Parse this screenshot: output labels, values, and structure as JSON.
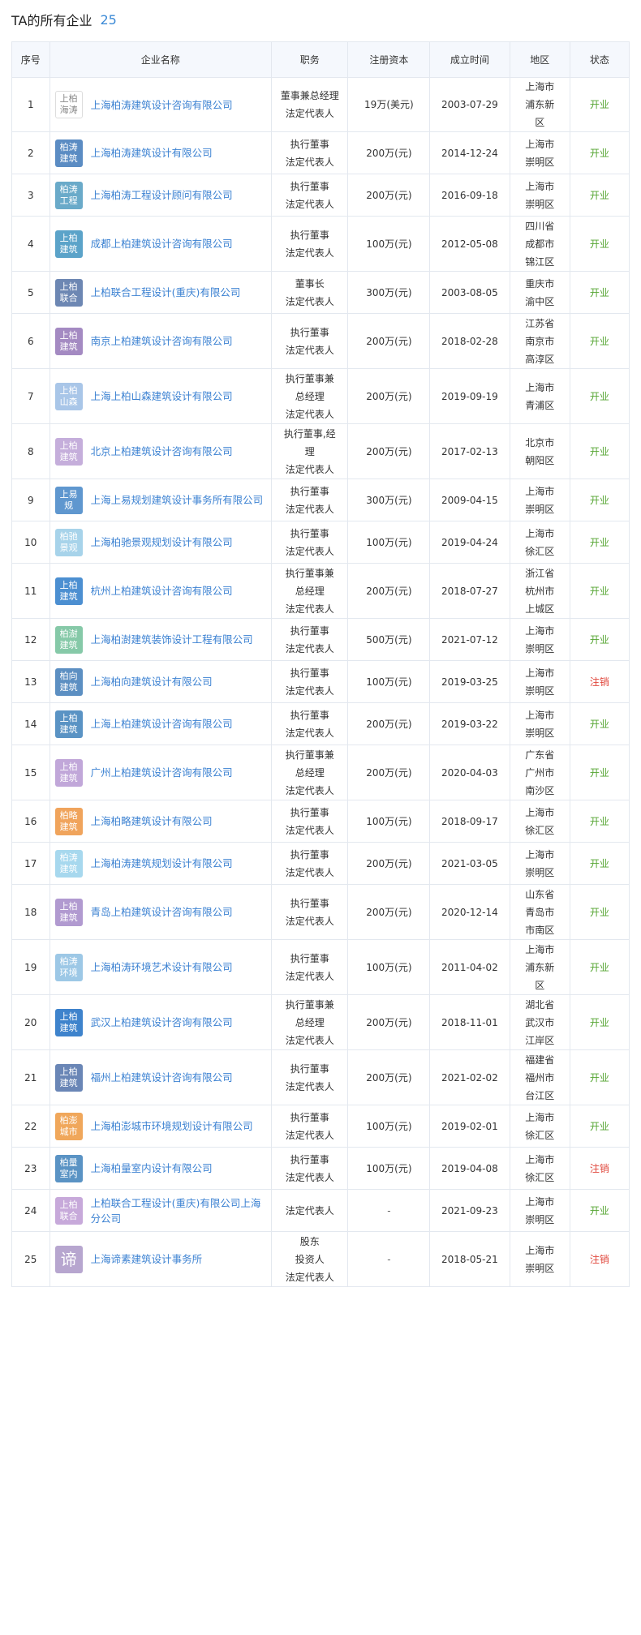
{
  "header": {
    "title": "TA的所有企业",
    "count": "25"
  },
  "columns": [
    "序号",
    "企业名称",
    "职务",
    "注册资本",
    "成立时间",
    "地区",
    "状态"
  ],
  "rows": [
    {
      "no": "1",
      "logo": "上柏\n海涛",
      "logo_color": "#ffffff",
      "logo_style": "light",
      "name": "上海柏涛建筑设计咨询有限公司",
      "role": "董事兼总经理\n法定代表人",
      "capital": "19万(美元)",
      "date": "2003-07-29",
      "region": "上海市\n浦东新\n区",
      "status": "开业"
    },
    {
      "no": "2",
      "logo": "柏涛\n建筑",
      "logo_color": "#5b8cc3",
      "name": "上海柏涛建筑设计有限公司",
      "role": "执行董事\n法定代表人",
      "capital": "200万(元)",
      "date": "2014-12-24",
      "region": "上海市\n崇明区",
      "status": "开业"
    },
    {
      "no": "3",
      "logo": "柏涛\n工程",
      "logo_color": "#6aaac9",
      "name": "上海柏涛工程设计顾问有限公司",
      "role": "执行董事\n法定代表人",
      "capital": "200万(元)",
      "date": "2016-09-18",
      "region": "上海市\n崇明区",
      "status": "开业"
    },
    {
      "no": "4",
      "logo": "上柏\n建筑",
      "logo_color": "#5ba3c9",
      "name": "成都上柏建筑设计咨询有限公司",
      "role": "执行董事\n法定代表人",
      "capital": "100万(元)",
      "date": "2012-05-08",
      "region": "四川省\n成都市\n锦江区",
      "status": "开业"
    },
    {
      "no": "5",
      "logo": "上柏\n联合",
      "logo_color": "#6d87b3",
      "name": "上柏联合工程设计(重庆)有限公司",
      "role": "董事长\n法定代表人",
      "capital": "300万(元)",
      "date": "2003-08-05",
      "region": "重庆市\n渝中区",
      "status": "开业"
    },
    {
      "no": "6",
      "logo": "上柏\n建筑",
      "logo_color": "#a48ac2",
      "name": "南京上柏建筑设计咨询有限公司",
      "role": "执行董事\n法定代表人",
      "capital": "200万(元)",
      "date": "2018-02-28",
      "region": "江苏省\n南京市\n高淳区",
      "status": "开业"
    },
    {
      "no": "7",
      "logo": "上柏\n山森",
      "logo_color": "#a9c6e8",
      "name": "上海上柏山森建筑设计有限公司",
      "role": "执行董事兼\n总经理\n法定代表人",
      "capital": "200万(元)",
      "date": "2019-09-19",
      "region": "上海市\n青浦区",
      "status": "开业"
    },
    {
      "no": "8",
      "logo": "上柏\n建筑",
      "logo_color": "#c5aedb",
      "name": "北京上柏建筑设计咨询有限公司",
      "role": "执行董事,经\n理\n法定代表人",
      "capital": "200万(元)",
      "date": "2017-02-13",
      "region": "北京市\n朝阳区",
      "status": "开业"
    },
    {
      "no": "9",
      "logo": "上易\n规",
      "logo_color": "#5f97cf",
      "name": "上海上易规划建筑设计事务所有限公司",
      "role": "执行董事\n法定代表人",
      "capital": "300万(元)",
      "date": "2009-04-15",
      "region": "上海市\n崇明区",
      "status": "开业"
    },
    {
      "no": "10",
      "logo": "柏驰\n景观",
      "logo_color": "#a7d3ea",
      "name": "上海柏驰景观规划设计有限公司",
      "role": "执行董事\n法定代表人",
      "capital": "100万(元)",
      "date": "2019-04-24",
      "region": "上海市\n徐汇区",
      "status": "开业"
    },
    {
      "no": "11",
      "logo": "上柏\n建筑",
      "logo_color": "#4c8fd1",
      "name": "杭州上柏建筑设计咨询有限公司",
      "role": "执行董事兼\n总经理\n法定代表人",
      "capital": "200万(元)",
      "date": "2018-07-27",
      "region": "浙江省\n杭州市\n上城区",
      "status": "开业"
    },
    {
      "no": "12",
      "logo": "柏澍\n建筑",
      "logo_color": "#86c9a8",
      "name": "上海柏澍建筑装饰设计工程有限公司",
      "role": "执行董事\n法定代表人",
      "capital": "500万(元)",
      "date": "2021-07-12",
      "region": "上海市\n崇明区",
      "status": "开业"
    },
    {
      "no": "13",
      "logo": "柏向\n建筑",
      "logo_color": "#5c8fc2",
      "name": "上海柏向建筑设计有限公司",
      "role": "执行董事\n法定代表人",
      "capital": "100万(元)",
      "date": "2019-03-25",
      "region": "上海市\n崇明区",
      "status": "注销"
    },
    {
      "no": "14",
      "logo": "上柏\n建筑",
      "logo_color": "#5a93c4",
      "name": "上海上柏建筑设计咨询有限公司",
      "role": "执行董事\n法定代表人",
      "capital": "200万(元)",
      "date": "2019-03-22",
      "region": "上海市\n崇明区",
      "status": "开业"
    },
    {
      "no": "15",
      "logo": "上柏\n建筑",
      "logo_color": "#c1a7d9",
      "name": "广州上柏建筑设计咨询有限公司",
      "role": "执行董事兼\n总经理\n法定代表人",
      "capital": "200万(元)",
      "date": "2020-04-03",
      "region": "广东省\n广州市\n南沙区",
      "status": "开业"
    },
    {
      "no": "16",
      "logo": "柏略\n建筑",
      "logo_color": "#f0a45c",
      "name": "上海柏略建筑设计有限公司",
      "role": "执行董事\n法定代表人",
      "capital": "100万(元)",
      "date": "2018-09-17",
      "region": "上海市\n徐汇区",
      "status": "开业"
    },
    {
      "no": "17",
      "logo": "柏涛\n建筑",
      "logo_color": "#a7d8ee",
      "name": "上海柏涛建筑规划设计有限公司",
      "role": "执行董事\n法定代表人",
      "capital": "200万(元)",
      "date": "2021-03-05",
      "region": "上海市\n崇明区",
      "status": "开业"
    },
    {
      "no": "18",
      "logo": "上柏\n建筑",
      "logo_color": "#b19ad0",
      "name": "青岛上柏建筑设计咨询有限公司",
      "role": "执行董事\n法定代表人",
      "capital": "200万(元)",
      "date": "2020-12-14",
      "region": "山东省\n青岛市\n市南区",
      "status": "开业"
    },
    {
      "no": "19",
      "logo": "柏涛\n环境",
      "logo_color": "#9dc8e6",
      "name": "上海柏涛环境艺术设计有限公司",
      "role": "执行董事\n法定代表人",
      "capital": "100万(元)",
      "date": "2011-04-02",
      "region": "上海市\n浦东新\n区",
      "status": "开业"
    },
    {
      "no": "20",
      "logo": "上柏\n建筑",
      "logo_color": "#3e83cc",
      "name": "武汉上柏建筑设计咨询有限公司",
      "role": "执行董事兼\n总经理\n法定代表人",
      "capital": "200万(元)",
      "date": "2018-11-01",
      "region": "湖北省\n武汉市\n江岸区",
      "status": "开业"
    },
    {
      "no": "21",
      "logo": "上柏\n建筑",
      "logo_color": "#6a86b6",
      "name": "福州上柏建筑设计咨询有限公司",
      "role": "执行董事\n法定代表人",
      "capital": "200万(元)",
      "date": "2021-02-02",
      "region": "福建省\n福州市\n台江区",
      "status": "开业"
    },
    {
      "no": "22",
      "logo": "柏澎\n城市",
      "logo_color": "#f0a75b",
      "name": "上海柏澎城市环境规划设计有限公司",
      "role": "执行董事\n法定代表人",
      "capital": "100万(元)",
      "date": "2019-02-01",
      "region": "上海市\n徐汇区",
      "status": "开业"
    },
    {
      "no": "23",
      "logo": "柏量\n室内",
      "logo_color": "#5a93c4",
      "name": "上海柏量室内设计有限公司",
      "role": "执行董事\n法定代表人",
      "capital": "100万(元)",
      "date": "2019-04-08",
      "region": "上海市\n徐汇区",
      "status": "注销"
    },
    {
      "no": "24",
      "logo": "上柏\n联合",
      "logo_color": "#c7a9da",
      "name": "上柏联合工程设计(重庆)有限公司上海分公司",
      "role": "法定代表人",
      "capital": "-",
      "date": "2021-09-23",
      "region": "上海市\n崇明区",
      "status": "开业"
    },
    {
      "no": "25",
      "logo": "谛",
      "logo_color": "#b7a6cf",
      "logo_style": "big",
      "name": "上海谛素建筑设计事务所",
      "role": "股东\n投资人\n法定代表人",
      "capital": "-",
      "date": "2018-05-21",
      "region": "上海市\n崇明区",
      "status": "注销"
    }
  ]
}
